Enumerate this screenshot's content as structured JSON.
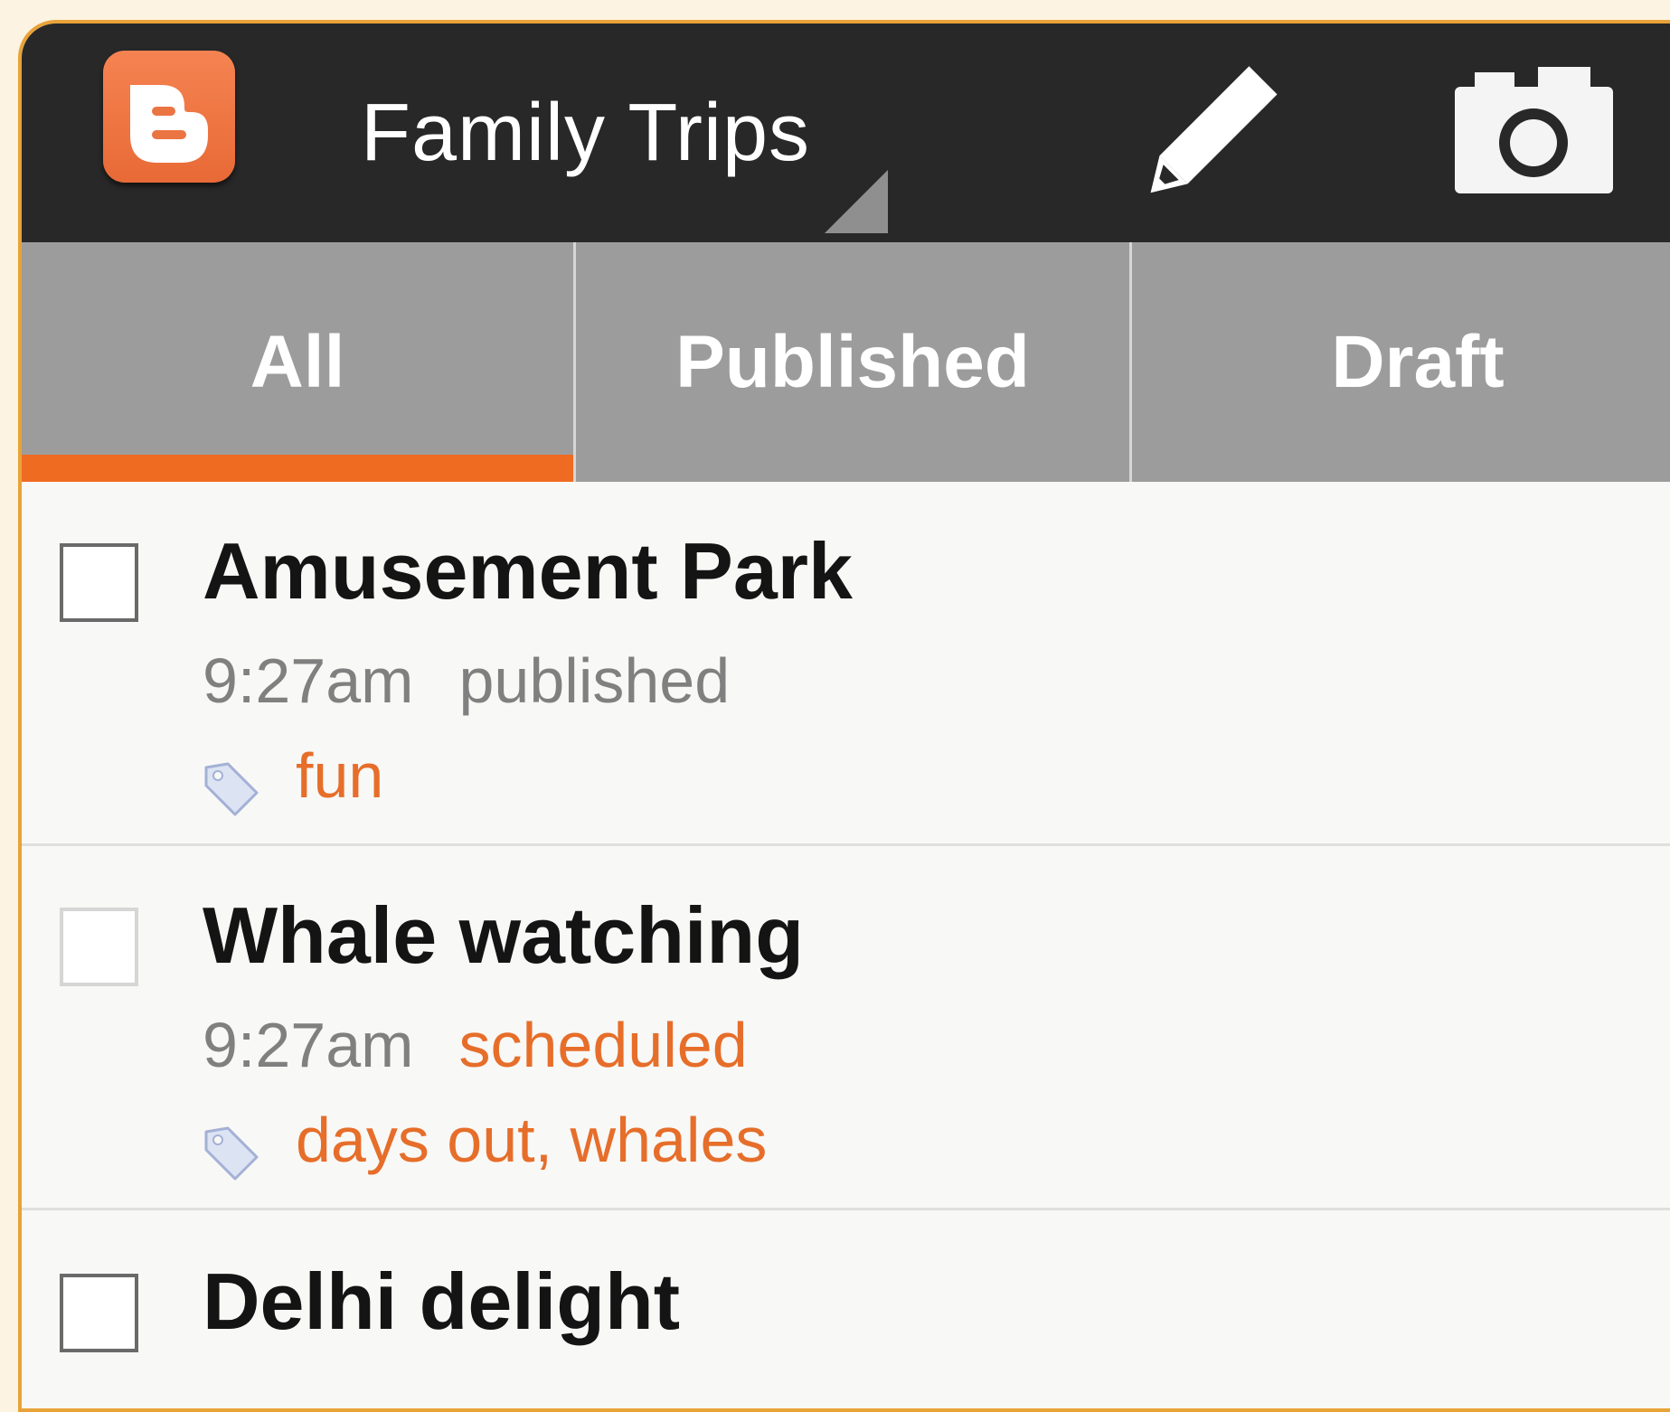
{
  "action_bar": {
    "blog_title": "Family Trips",
    "logo_icon": "blogger-logo-icon",
    "compose_icon": "pencil-icon",
    "camera_icon": "camera-icon",
    "background_color": "#282828"
  },
  "tabs": [
    {
      "label": "All",
      "selected": true
    },
    {
      "label": "Published",
      "selected": false
    },
    {
      "label": "Draft",
      "selected": false
    }
  ],
  "accent_color": "#f06b22",
  "posts": [
    {
      "title": "Amusement Park",
      "time": "9:27am",
      "status": "published",
      "tags": "fun",
      "checked": false
    },
    {
      "title": "Whale watching",
      "time": "9:27am",
      "status": "scheduled",
      "tags": "days out, whales",
      "checked": false
    },
    {
      "title": "Delhi delight",
      "checked": false
    }
  ]
}
